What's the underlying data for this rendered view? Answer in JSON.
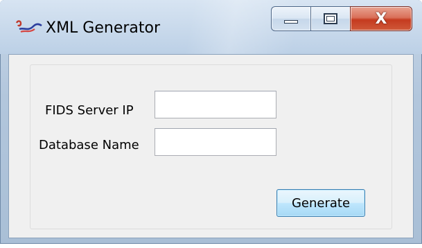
{
  "window": {
    "title": "XML Generator",
    "icon": "xml-app-icon",
    "caption_buttons": {
      "minimize_icon": "minimize-icon",
      "maximize_icon": "maximize-icon",
      "close_glyph": "X"
    }
  },
  "form": {
    "fields": [
      {
        "label": "FIDS Server IP",
        "value": ""
      },
      {
        "label": "Database Name",
        "value": ""
      }
    ],
    "generate_label": "Generate"
  },
  "colors": {
    "close_button": "#c53a1f",
    "button_border": "#3c7fb1",
    "client_background": "#f0f0f0"
  }
}
